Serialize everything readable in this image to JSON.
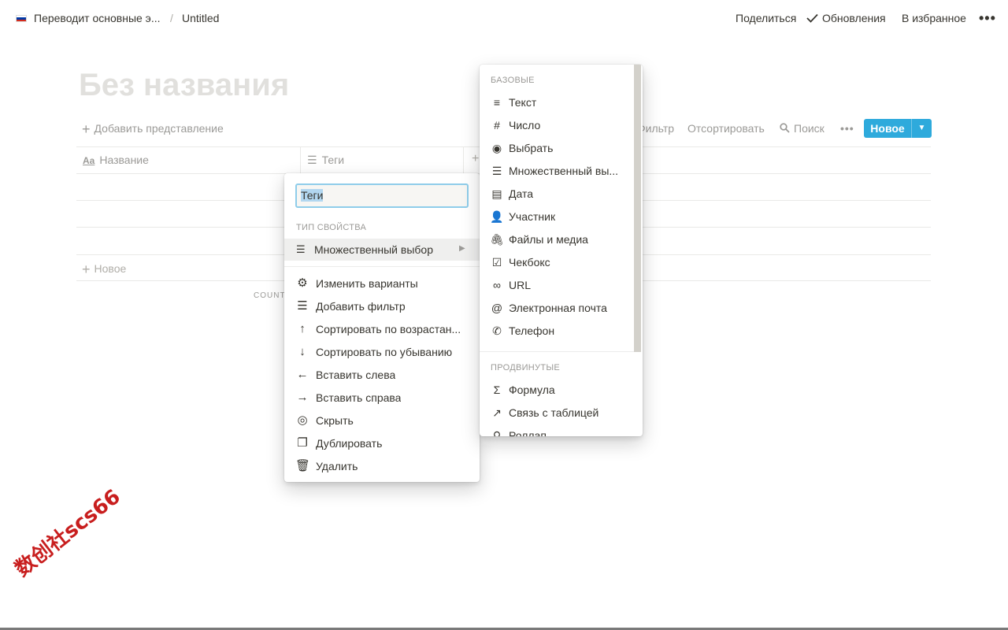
{
  "topbar": {
    "breadcrumb": [
      "Переводит основные э...",
      "Untitled"
    ],
    "separator": "/",
    "share": "Поделиться",
    "updates": "Обновления",
    "favorite": "В избранное",
    "more": "•••"
  },
  "page": {
    "title": "Без названия",
    "add_view": "Добавить представление",
    "toolbar": {
      "filter": "Фильтр",
      "sort": "Отсортировать",
      "search": "Поиск",
      "more": "•••",
      "new_button": "Новое"
    },
    "table": {
      "columns": [
        {
          "icon": "Aa",
          "label": "Название"
        },
        {
          "icon": "list-icon",
          "label": "Теги"
        }
      ],
      "new_row": "Новое",
      "count_label": "COUNT"
    }
  },
  "property_menu": {
    "name_value": "Теги",
    "section_label": "ТИП СВОЙСТВА",
    "current_type": "Множественный выбор",
    "actions": [
      {
        "icon": "gear-icon",
        "label": "Изменить варианты"
      },
      {
        "icon": "filter-icon",
        "label": "Добавить фильтр"
      },
      {
        "icon": "arrow-up-icon",
        "label": "Сортировать по возрастан..."
      },
      {
        "icon": "arrow-down-icon",
        "label": "Сортировать по убыванию"
      },
      {
        "icon": "arrow-left-icon",
        "label": "Вставить слева"
      },
      {
        "icon": "arrow-right-icon",
        "label": "Вставить справа"
      },
      {
        "icon": "eye-off-icon",
        "label": "Скрыть"
      },
      {
        "icon": "duplicate-icon",
        "label": "Дублировать"
      },
      {
        "icon": "trash-icon",
        "label": "Удалить"
      }
    ]
  },
  "type_menu": {
    "basic_label": "БАЗОВЫЕ",
    "basic": [
      {
        "icon": "text-icon",
        "label": "Текст"
      },
      {
        "icon": "number-icon",
        "label": "Число"
      },
      {
        "icon": "select-icon",
        "label": "Выбрать"
      },
      {
        "icon": "multi-select-icon",
        "label": "Множественный вы..."
      },
      {
        "icon": "calendar-icon",
        "label": "Дата"
      },
      {
        "icon": "person-icon",
        "label": "Участник"
      },
      {
        "icon": "paperclip-icon",
        "label": "Файлы и медиа"
      },
      {
        "icon": "checkbox-icon",
        "label": "Чекбокс"
      },
      {
        "icon": "link-icon",
        "label": "URL"
      },
      {
        "icon": "at-icon",
        "label": "Электронная почта"
      },
      {
        "icon": "phone-icon",
        "label": "Телефон"
      }
    ],
    "advanced_label": "ПРОДВИНУТЫЕ",
    "advanced": [
      {
        "icon": "sigma-icon",
        "label": "Формула"
      },
      {
        "icon": "relation-icon",
        "label": "Связь с таблицей"
      },
      {
        "icon": "search-icon",
        "label": "Роллап"
      }
    ]
  },
  "watermark": "数创社scs66",
  "colors": {
    "accent": "#2eaadc",
    "text": "#37352f",
    "muted": "#9b9a97",
    "watermark": "#c81e1e"
  }
}
